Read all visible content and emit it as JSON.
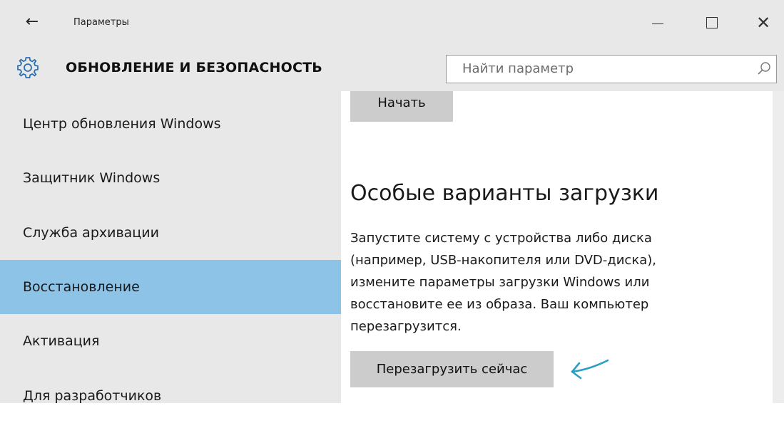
{
  "window": {
    "title": "Параметры",
    "back_icon": "back-arrow-icon",
    "minimize_icon": "minimize-icon",
    "maximize_icon": "maximize-icon",
    "close_icon": "close-icon"
  },
  "header": {
    "icon": "gear-icon",
    "title": "ОБНОВЛЕНИЕ И БЕЗОПАСНОСТЬ",
    "search_placeholder": "Найти параметр",
    "search_icon": "search-icon"
  },
  "sidebar": {
    "items": [
      {
        "label": "Центр обновления Windows",
        "active": false
      },
      {
        "label": "Защитник Windows",
        "active": false
      },
      {
        "label": "Служба архивации",
        "active": false
      },
      {
        "label": "Восстановление",
        "active": true
      },
      {
        "label": "Активация",
        "active": false
      },
      {
        "label": "Для разработчиков",
        "active": false
      }
    ],
    "active_color": "#8ec3e8"
  },
  "main": {
    "start_button": "Начать",
    "heading": "Особые варианты загрузки",
    "description_lines": [
      "Запустите систему с устройства либо диска",
      "(например, USB-накопителя или DVD-диска),",
      "измените параметры загрузки Windows или",
      "восстановите ее из образа. Ваш компьютер",
      "перезагрузится."
    ],
    "restart_button": "Перезагрузить сейчас",
    "annotation_arrow_color": "#2a9fc4"
  }
}
